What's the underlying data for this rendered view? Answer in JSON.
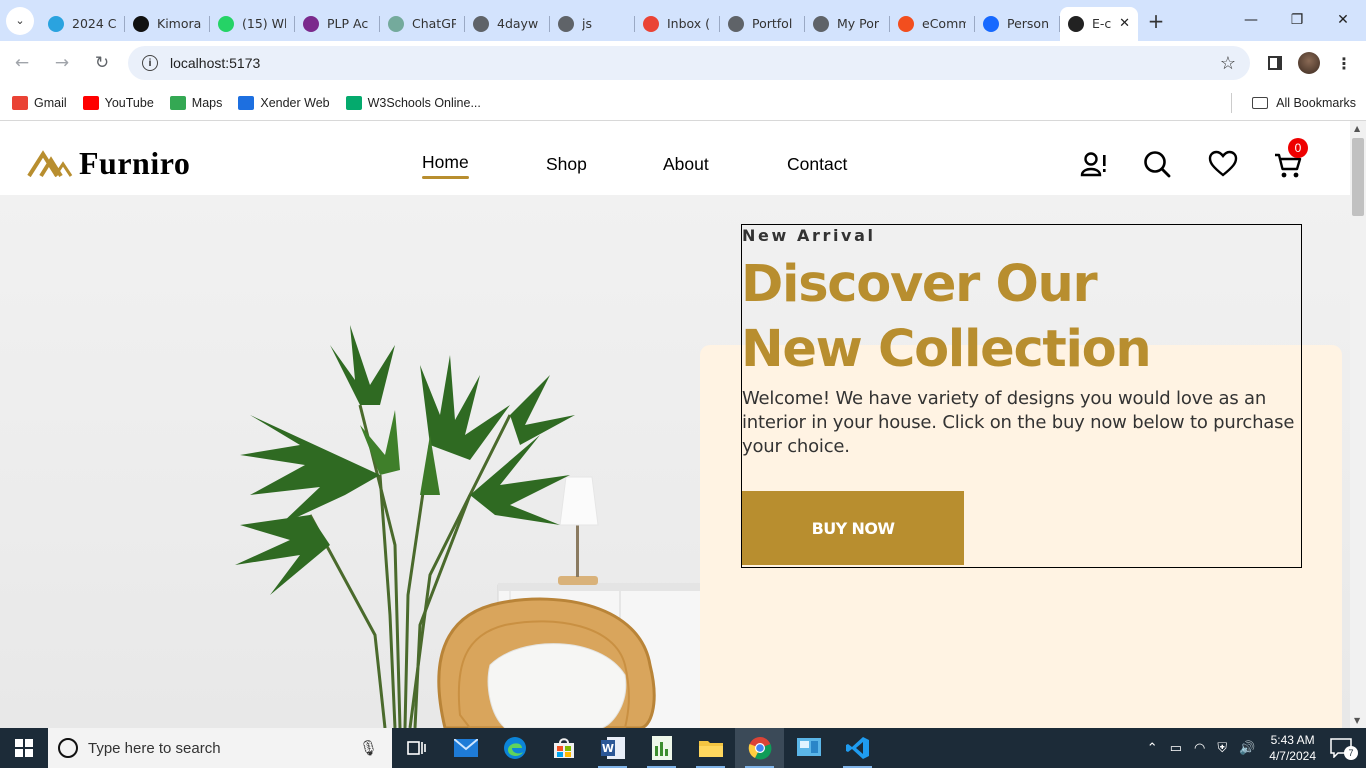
{
  "browser": {
    "tabs": [
      {
        "title": "2024 C",
        "favicon": "telegram-icon",
        "color": "#2aa3df"
      },
      {
        "title": "Kimora",
        "favicon": "github-icon",
        "color": "#111111"
      },
      {
        "title": "(15) Wh",
        "favicon": "whatsapp-icon",
        "color": "#25d366"
      },
      {
        "title": "PLP Ac",
        "favicon": "plp-icon",
        "color": "#7b2a8c"
      },
      {
        "title": "ChatGP",
        "favicon": "chatgpt-icon",
        "color": "#74aa9c"
      },
      {
        "title": "4dayw",
        "favicon": "globe-icon",
        "color": "#5f6368"
      },
      {
        "title": "js",
        "favicon": "globe-icon",
        "color": "#5f6368"
      },
      {
        "title": "Inbox (",
        "favicon": "gmail-icon",
        "color": "#ea4335"
      },
      {
        "title": "Portfol",
        "favicon": "globe-icon",
        "color": "#5f6368"
      },
      {
        "title": "My Por",
        "favicon": "globe-icon",
        "color": "#5f6368"
      },
      {
        "title": "eComm",
        "favicon": "figma-icon",
        "color": "#f24e1e"
      },
      {
        "title": "Person",
        "favicon": "behance-icon",
        "color": "#1769ff"
      },
      {
        "title": "E-c",
        "favicon": "page-icon",
        "color": "#222222",
        "active": true
      }
    ],
    "url": "localhost:5173",
    "bookmarks": [
      {
        "label": "Gmail",
        "icon": "gmail-icon"
      },
      {
        "label": "YouTube",
        "icon": "youtube-icon"
      },
      {
        "label": "Maps",
        "icon": "maps-icon"
      },
      {
        "label": "Xender Web",
        "icon": "xender-icon"
      },
      {
        "label": "W3Schools Online...",
        "icon": "w3schools-icon"
      }
    ],
    "all_bookmarks": "All Bookmarks"
  },
  "site": {
    "brand": "Furniro",
    "nav": {
      "home": "Home",
      "shop": "Shop",
      "about": "About",
      "contact": "Contact"
    },
    "cart_count": "0",
    "accent": "#b88e2f"
  },
  "hero": {
    "kicker": "New Arrival",
    "headline_line1": "Discover Our",
    "headline_line2": "New Collection",
    "blurb": "Welcome! We have variety of designs you would love as an interior in your house. Click on the buy now below to purchase your choice.",
    "cta": "BUY NOW",
    "card_bg": "#fff3e3"
  },
  "taskbar": {
    "search_placeholder": "Type here to search",
    "time": "5:43 AM",
    "date": "4/7/2024",
    "notifications": "7"
  }
}
